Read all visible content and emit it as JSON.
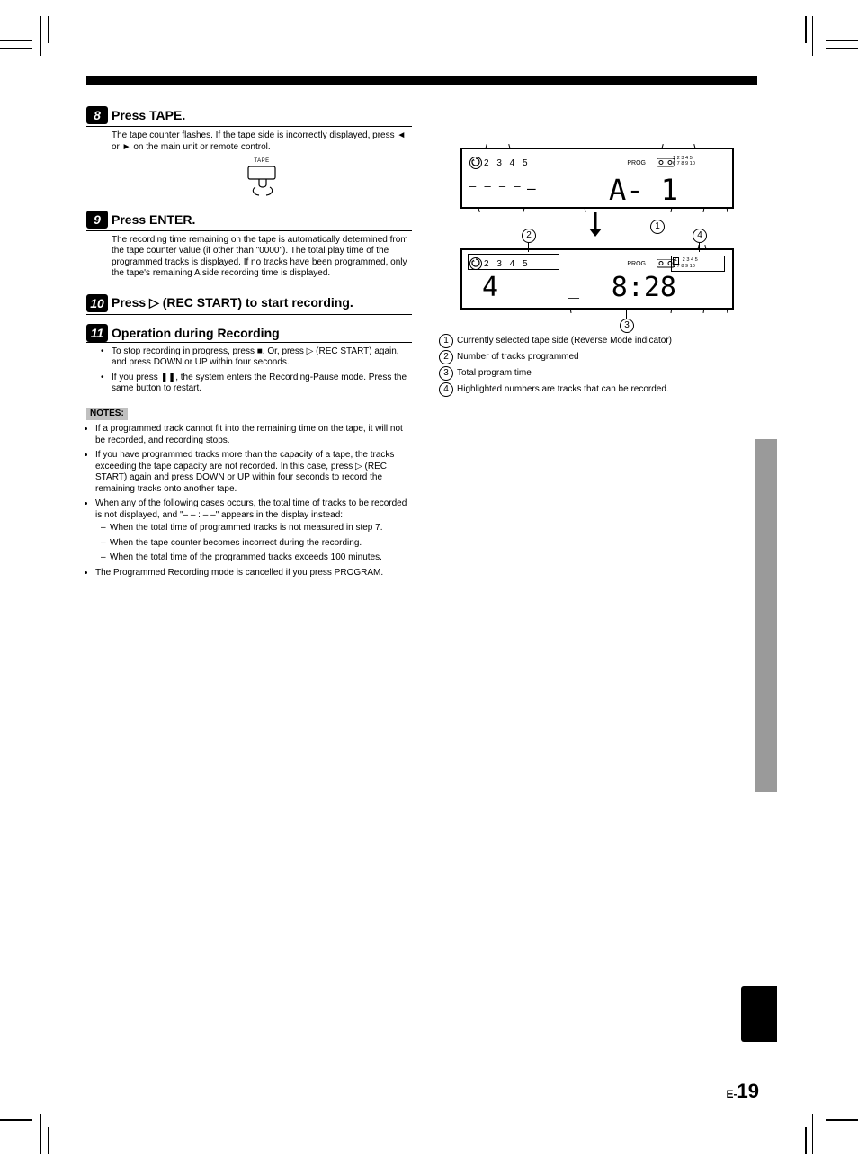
{
  "page": {
    "prefix": "E-",
    "number": "19"
  },
  "steps": {
    "s8": {
      "num": "8",
      "label": "Press TAPE.",
      "body": "The tape counter flashes. If the tape side is incorrectly displayed, press ◄ or ► on the main unit or remote control.",
      "button_label": "TAPE"
    },
    "s9": {
      "num": "9",
      "label": "Press ENTER.",
      "body": "The recording time remaining on the tape is automatically determined from the tape counter value (if other than \"0000\"). The total play time of the programmed tracks is displayed. If no tracks have been programmed, only the tape's remaining A side recording time is displayed."
    },
    "s10": {
      "num": "10",
      "label": "Press ▷ (REC START) to start recording."
    },
    "s11": {
      "num": "11",
      "label": "",
      "intro": "Operation during Recording",
      "bullets": [
        "To stop recording in progress, press ■. Or, press ▷ (REC START) again, and press DOWN or UP within four seconds.",
        "If you press ❚❚, the system enters the Recording-Pause mode. Press the same button to restart."
      ]
    }
  },
  "notes": {
    "header": "NOTES:",
    "items": [
      {
        "text": "If a programmed track cannot fit into the remaining time on the tape, it will not be recorded, and recording stops."
      },
      {
        "text": "If you have programmed tracks more than the capacity of a tape, the tracks exceeding the tape capacity are not recorded. In this case, press ▷ (REC START) again and press DOWN or UP within four seconds to record the remaining tracks onto another tape."
      },
      {
        "text": "When any of the following cases occurs, the total time of tracks to be recorded is not displayed, and \"– – : – –\" appears in the display instead:",
        "sub": [
          "When the total time of programmed tracks is not measured in step 7.",
          "When the tape counter becomes incorrect during the recording.",
          "When the total time of the programmed tracks exceeds 100 minutes."
        ]
      },
      {
        "text": "The Programmed Recording mode is cancelled if you press PROGRAM."
      }
    ]
  },
  "lcd": {
    "top": {
      "discs": "2 3 4 5",
      "cur": "1",
      "prog": "PROG",
      "cal_r1": "1 2 3 4 5",
      "cal_r2": "6 7 8 9 10",
      "big": "A- 1"
    },
    "bottom": {
      "discs": "2 3 4 5",
      "cur": "1",
      "prog": "PROG",
      "cal_r1": "  2 3 4 5",
      "cal_r2": "6 7 8 9 10",
      "left_big": "4",
      "mid": "_",
      "right_big": "8:28",
      "cal_box": "1"
    }
  },
  "annotations": {
    "a1": "Currently selected tape side (Reverse Mode indicator)",
    "a2": "Number of tracks programmed",
    "a3": "Total program time",
    "a4": "Highlighted numbers are tracks that can be recorded."
  }
}
